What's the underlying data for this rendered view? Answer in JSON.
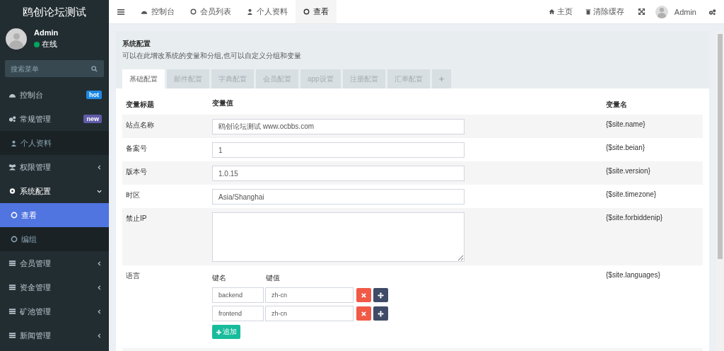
{
  "sidebar": {
    "logo": "鸥创论坛测试",
    "user": {
      "name": "Admin",
      "status": {
        "label": "在线",
        "color": "#00a65a"
      }
    },
    "search": {
      "placeholder": "搜索菜单"
    },
    "items": [
      {
        "label": "控制台",
        "selected": false,
        "badge": {
          "label": "hot",
          "color": "#1e88e5"
        }
      },
      {
        "label": "常规管理",
        "selected": false,
        "badge": {
          "label": "new",
          "color": "#605ca8"
        },
        "children": [
          {
            "label": "个人资料",
            "selected": false
          }
        ]
      },
      {
        "label": "权限管理",
        "selected": false,
        "expanded": false
      },
      {
        "label": "系统配置",
        "selected": false,
        "expanded": true,
        "children": [
          {
            "label": "查看",
            "selected": true
          },
          {
            "label": "编组",
            "selected": false
          }
        ]
      },
      {
        "label": "会员管理",
        "selected": false,
        "expanded": false
      },
      {
        "label": "资金管理",
        "selected": false,
        "expanded": false
      },
      {
        "label": "矿池管理",
        "selected": false,
        "expanded": false
      },
      {
        "label": "新闻管理",
        "selected": false,
        "expanded": false
      }
    ]
  },
  "topbar": {
    "tabs": [
      {
        "label": "控制台",
        "selected": false
      },
      {
        "label": "会员列表",
        "selected": false
      },
      {
        "label": "个人资料",
        "selected": false
      },
      {
        "label": "查看",
        "selected": true
      }
    ],
    "links": [
      "主页",
      "清除缓存"
    ],
    "user": "Admin"
  },
  "panel": {
    "title": "系统配置",
    "description": "可以在此增改系统的变量和分组,也可以自定义分组和变量",
    "tabs": [
      {
        "label": "基础配置",
        "selected": true
      },
      {
        "label": "邮件配置",
        "selected": false
      },
      {
        "label": "字典配置",
        "selected": false
      },
      {
        "label": "会员配置",
        "selected": false
      },
      {
        "label": "app设置",
        "selected": false
      },
      {
        "label": "注册配置",
        "selected": false
      },
      {
        "label": "汇率配置",
        "selected": false
      },
      {
        "label": "+",
        "selected": false
      }
    ],
    "columns": [
      "变量标题",
      "变量值",
      "变量名"
    ],
    "rows": [
      {
        "kind": "text",
        "title": "站点名称",
        "value": "鸥创论坛测试 www.ocbbs.com",
        "name": "{$site.name}"
      },
      {
        "kind": "text",
        "title": "备案号",
        "value": "1",
        "name": "{$site.beian}"
      },
      {
        "kind": "text",
        "title": "版本号",
        "value": "1.0.15",
        "name": "{$site.version}"
      },
      {
        "kind": "text",
        "title": "时区",
        "value": "Asia/Shanghai",
        "name": "{$site.timezone}"
      },
      {
        "kind": "textarea",
        "title": "禁止IP",
        "value": "",
        "name": "{$site.forbiddenip}"
      },
      {
        "kind": "keyvalue",
        "title": "语言",
        "name": "{$site.languages}",
        "key_header": "键名",
        "value_header": "键值",
        "pairs": [
          {
            "key": "backend",
            "value": "zh-cn"
          },
          {
            "key": "frontend",
            "value": "zh-cn"
          }
        ],
        "add_label": "追加"
      }
    ]
  }
}
